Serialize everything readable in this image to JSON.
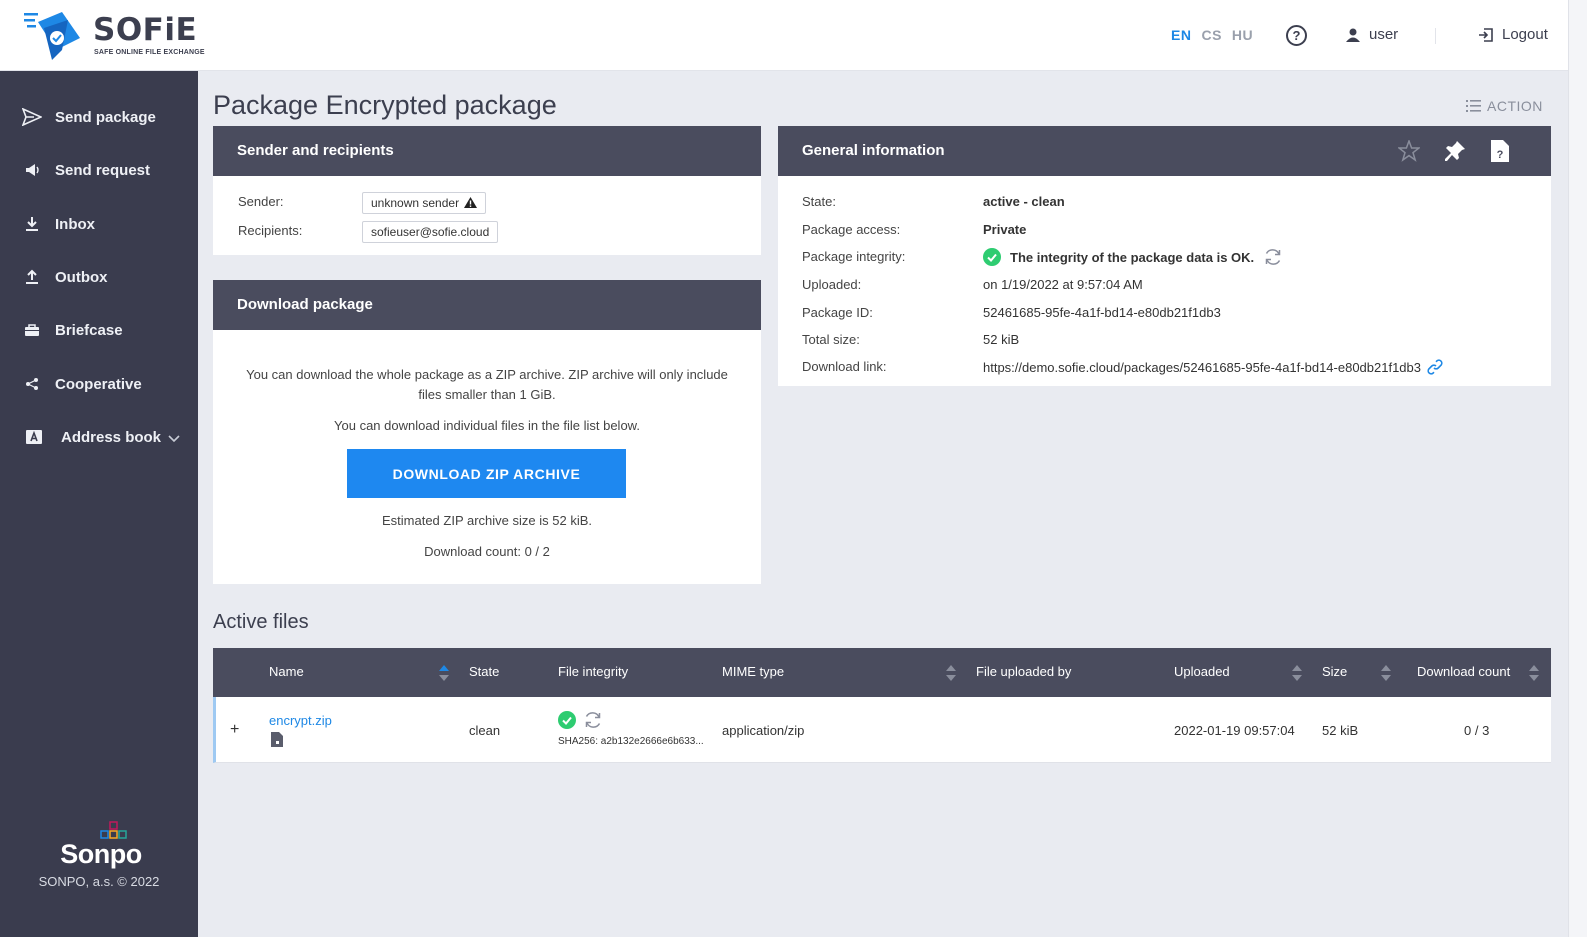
{
  "header": {
    "logo_word": "SOFiE",
    "logo_tagline": "SAFE ONLINE FILE EXCHANGE",
    "languages": [
      {
        "code": "EN",
        "active": true
      },
      {
        "code": "CS",
        "active": false
      },
      {
        "code": "HU",
        "active": false
      }
    ],
    "help_glyph": "?",
    "user_label": "user",
    "logout_label": "Logout"
  },
  "sidebar": {
    "items": [
      {
        "label": "Send package",
        "icon": "send-icon"
      },
      {
        "label": "Send request",
        "icon": "megaphone-icon"
      },
      {
        "label": "Inbox",
        "icon": "download-icon"
      },
      {
        "label": "Outbox",
        "icon": "upload-icon"
      },
      {
        "label": "Briefcase",
        "icon": "briefcase-icon"
      },
      {
        "label": "Cooperative",
        "icon": "share-icon"
      },
      {
        "label": "Address book",
        "icon": "address-book-icon"
      }
    ],
    "footer_brand": "Sonpo",
    "footer_copy": "SONPO, a.s. © 2022"
  },
  "page": {
    "title": "Package Encrypted package",
    "action_label": "ACTION"
  },
  "sender_card": {
    "title": "Sender and recipients",
    "sender_label": "Sender:",
    "sender_value": "unknown sender",
    "recipients_label": "Recipients:",
    "recipients_value": "sofieuser@sofie.cloud"
  },
  "download_card": {
    "title": "Download package",
    "text1": "You can download the whole package as a ZIP archive. ZIP archive will only include files smaller than 1 GiB.",
    "text2": "You can download individual files in the file list below.",
    "button_label": "DOWNLOAD ZIP ARCHIVE",
    "size_text": "Estimated ZIP archive size is 52 kiB.",
    "count_text": "Download count: 0 / 2"
  },
  "general_card": {
    "title": "General information",
    "rows": [
      {
        "label": "State:",
        "value": "active - clean"
      },
      {
        "label": "Package access:",
        "value": "Private"
      },
      {
        "label": "Package integrity:",
        "value": "The integrity of the package data is OK."
      },
      {
        "label": "Uploaded:",
        "value": "on 1/19/2022 at 9:57:04 AM"
      },
      {
        "label": "Package ID:",
        "value": "52461685-95fe-4a1f-bd14-e80db21f1db3"
      },
      {
        "label": "Total size:",
        "value": "52 kiB"
      },
      {
        "label": "Download link:",
        "value": "https://demo.sofie.cloud/packages/52461685-95fe-4a1f-bd14-e80db21f1db3"
      }
    ]
  },
  "files": {
    "section_title": "Active files",
    "columns": [
      "Name",
      "State",
      "File integrity",
      "MIME type",
      "File uploaded by",
      "Uploaded",
      "Size",
      "Download count"
    ],
    "rows": [
      {
        "expand": "+",
        "name": "encrypt.zip",
        "state": "clean",
        "hash": "SHA256: a2b132e2666e6b633...",
        "mime": "application/zip",
        "uploaded_by": "",
        "uploaded": "2022-01-19 09:57:04",
        "size": "52 kiB",
        "download_count": "0 / 3"
      }
    ]
  },
  "colors": {
    "sidebar_bg": "#3a3c4e",
    "header_bar": "#4a4c5e",
    "accent_blue": "#1e88f0",
    "ok_green": "#2ecc71"
  }
}
